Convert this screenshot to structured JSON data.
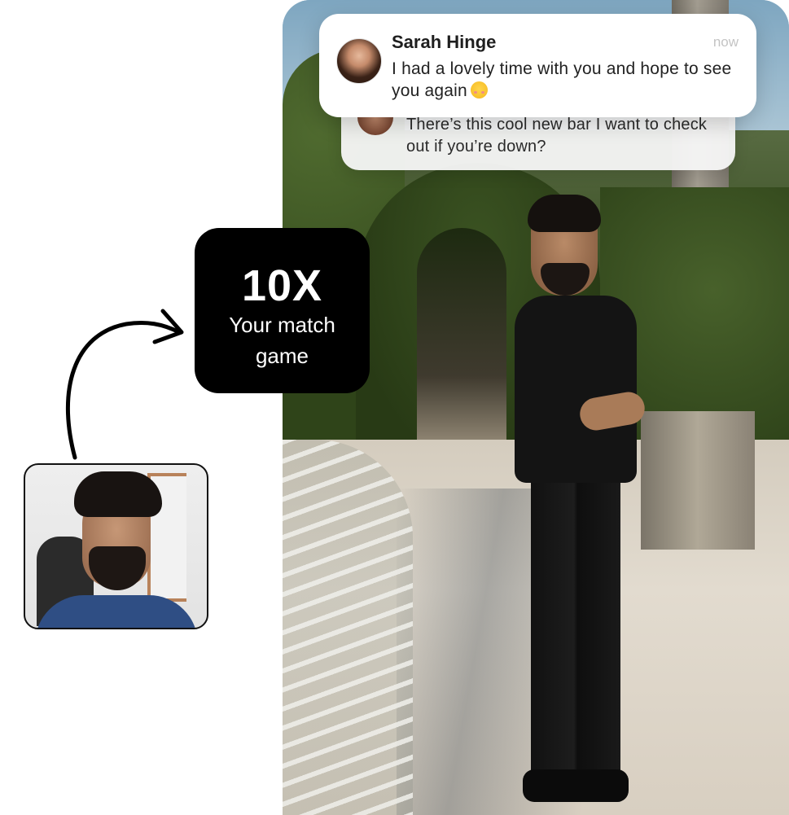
{
  "notifications": {
    "front": {
      "sender": "Sarah Hinge",
      "time": "now",
      "message": "I had a lovely time with you and hope to see you again"
    },
    "back": {
      "message": "There’s this cool new bar I want to check out if you’re down?"
    }
  },
  "badge": {
    "multiplier": "10X",
    "line1": "Your match",
    "line2": "game"
  },
  "icons": {
    "arrow": "curved-arrow-icon",
    "emoji": "smiling-blush-emoji-icon"
  },
  "colors": {
    "badge_bg": "#000000",
    "badge_text": "#ffffff",
    "card_bg": "#ffffff",
    "time_text": "#c4c4c4"
  }
}
